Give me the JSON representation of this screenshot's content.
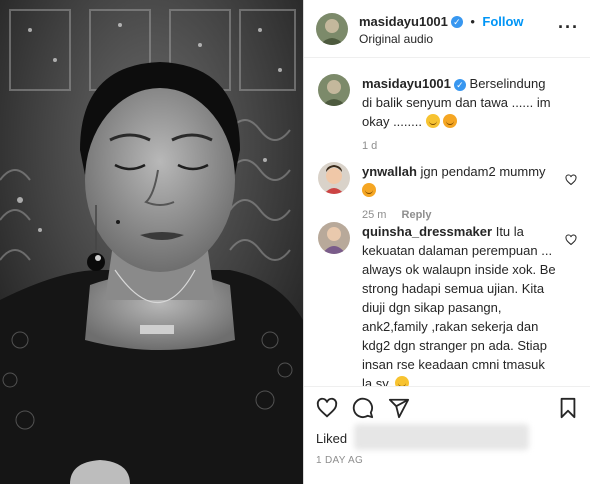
{
  "header": {
    "username": "masidayu1001",
    "follow_label": "Follow",
    "audio": "Original audio",
    "more_label": "···"
  },
  "caption": {
    "username": "masidayu1001",
    "text": "Berselindung di balik senyum dan tawa ...... im okay ........",
    "time": "1 d"
  },
  "comments": [
    {
      "username": "ynwallah",
      "text": "jgn pendam2 mummy",
      "time": "25 m",
      "reply_label": "Reply"
    },
    {
      "username": "quinsha_dressmaker",
      "text": "Itu la kekuatan dalaman perempuan ... always ok walaupn inside xok. Be strong hadapi semua ujian. Kita diuji dgn sikap pasangn, ank2,family ,rakan sekerja dan kdg2 dgn stranger pn ada. Stiap insan rse keadaan cmni tmasuk la sy."
    }
  ],
  "footer": {
    "liked_label": "Liked",
    "date": "1 DAY AG"
  },
  "colors": {
    "accent": "#0095f6",
    "verified": "#3897f0",
    "muted": "#8e8e8e"
  },
  "icons": [
    "heart-icon",
    "comment-icon",
    "share-icon",
    "bookmark-icon",
    "more-icon",
    "verified-icon"
  ]
}
